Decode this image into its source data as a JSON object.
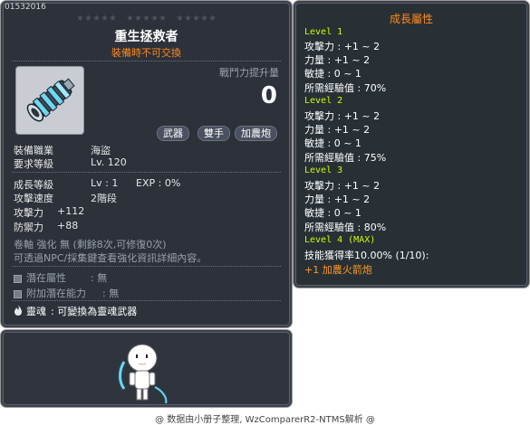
{
  "item": {
    "id": "01532016",
    "name": "重生拯救者",
    "untradable": "裝備時不可交換",
    "boost_label": "戰鬥力提升量",
    "boost_value": "0",
    "tags": [
      "武器",
      "雙手",
      "加農炮"
    ]
  },
  "requirements": [
    {
      "label": "裝備職業",
      "value": "海盜"
    },
    {
      "label": "要求等級",
      "value": "Lv. 120"
    }
  ],
  "growth": {
    "label": "成長等級",
    "level": "Lv  : 1",
    "exp": "EXP : 0%"
  },
  "stats": [
    {
      "label": "攻擊速度",
      "value": "2階段"
    },
    {
      "label": "攻擊力",
      "value": "+112"
    },
    {
      "label": "防禦力",
      "value": "+88"
    }
  ],
  "upgrade": {
    "line1": "卷軸 強化 無 (剩餘8次,可修復0次)",
    "line2": "可透過NPC/採集鍵查看強化資訊詳細內容。"
  },
  "potential": [
    {
      "label": "潛在屬性",
      "value": ": 無"
    },
    {
      "label": "附加潛在能力",
      "value": ": 無"
    }
  ],
  "soul": {
    "label": "靈魂",
    "value": ": 可變換為靈魂武器"
  },
  "growth_props": {
    "title": "成長屬性",
    "levels": [
      {
        "name": "Level 1",
        "lines": [
          "攻擊力 : +1 ~ 2",
          "力量 : +1 ~ 2",
          "敏捷 : 0 ~ 1",
          "所需經驗值 : 70%"
        ]
      },
      {
        "name": "Level 2",
        "lines": [
          "攻擊力 : +1 ~ 2",
          "力量 : +1 ~ 2",
          "敏捷 : 0 ~ 1",
          "所需經驗值 : 75%"
        ]
      },
      {
        "name": "Level 3",
        "lines": [
          "攻擊力 : +1 ~ 2",
          "力量 : +1 ~ 2",
          "敏捷 : 0 ~ 1",
          "所需經驗值 : 80%"
        ]
      },
      {
        "name": "Level 4 (MAX)",
        "lines": [
          "技能獲得率10.00% (1/10):"
        ]
      }
    ],
    "bonus": "+1 加農火箭炮"
  },
  "footer": "@ 数据由小册子整理, WzComparerR2-NTMS解析 @",
  "colors": {
    "accent_orange": "#ff8a1e",
    "level_green": "#c8ff00",
    "panel_bg": "#2c313a"
  },
  "icons": {
    "item": "cannon-weapon-icon",
    "soul": "flame-icon"
  }
}
